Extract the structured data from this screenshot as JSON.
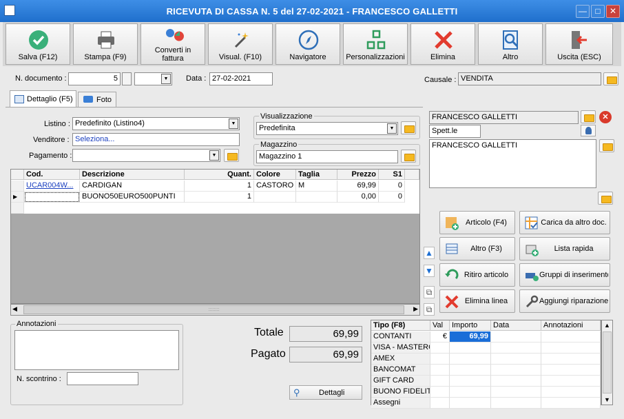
{
  "window": {
    "title": "RICEVUTA DI CASSA N. 5 del 27-02-2021 - FRANCESCO GALLETTI",
    "min": "—",
    "max": "□",
    "close": "✕"
  },
  "toolbar": [
    {
      "label": "Salva (F12)",
      "icon": "check-icon"
    },
    {
      "label": "Stampa (F9)",
      "icon": "printer-icon"
    },
    {
      "label": "Converti in fattura",
      "icon": "convert-icon"
    },
    {
      "label": "Visual. (F10)",
      "icon": "magic-wand-icon"
    },
    {
      "label": "Navigatore",
      "icon": "compass-icon"
    },
    {
      "label": "Personalizzazioni",
      "icon": "grid-icon"
    },
    {
      "label": "Elimina",
      "icon": "delete-x-icon"
    },
    {
      "label": "Altro",
      "icon": "search-doc-icon"
    },
    {
      "label": "Uscita (ESC)",
      "icon": "exit-icon"
    }
  ],
  "header": {
    "doc_label": "N. documento :",
    "doc_number": "5",
    "date_label": "Data :",
    "date": "27-02-2021",
    "causale_label": "Causale :",
    "causale": "VENDITA"
  },
  "tabs": [
    {
      "label": "Dettaglio (F5)"
    },
    {
      "label": "Foto"
    }
  ],
  "form": {
    "listino_label": "Listino :",
    "listino": "Predefinito (Listino4)",
    "venditore_label": "Venditore :",
    "venditore": "Seleziona...",
    "pagamento_label": "Pagamento :",
    "pagamento": "",
    "visual_label": "Visualizzazione",
    "visual": "Predefinita",
    "magazzino_label": "Magazzino",
    "magazzino": "Magazzino 1"
  },
  "customer": {
    "name": "FRANCESCO GALLETTI",
    "salutation": "Spett.le",
    "address": "FRANCESCO GALLETTI"
  },
  "grid": {
    "columns": [
      "Cod.",
      "Descrizione",
      "Quant.",
      "Colore",
      "Taglia",
      "Prezzo",
      "S1"
    ],
    "rows": [
      [
        "UCAR004W...",
        "CARDIGAN",
        "1",
        "CASTORO",
        "M",
        "69,99",
        "0"
      ],
      [
        "",
        "BUONO50EURO500PUNTI",
        "1",
        "",
        "",
        "0,00",
        "0"
      ]
    ],
    "scroll_grip": "::::::::"
  },
  "actions": [
    {
      "label": "Articolo (F4)",
      "icon": "add-article-icon"
    },
    {
      "label": "Carica da altro doc.",
      "icon": "load-doc-icon"
    },
    {
      "label": "Altro (F3)",
      "icon": "more-rows-icon"
    },
    {
      "label": "Lista rapida",
      "icon": "quick-list-icon"
    },
    {
      "label": "Ritiro articolo",
      "icon": "return-arrow-icon"
    },
    {
      "label": "Gruppi di inserimento",
      "icon": "group-insert-icon"
    },
    {
      "label": "Elimina linea",
      "icon": "delete-line-icon"
    },
    {
      "label": "Aggiungi riparazione",
      "icon": "wrench-icon"
    }
  ],
  "notes": {
    "label": "Annotazioni",
    "scontrino_label": "N. scontrino :"
  },
  "totals": {
    "totale_label": "Totale",
    "totale": "69,99",
    "pagato_label": "Pagato",
    "pagato": "69,99",
    "dettagli": "Dettagli"
  },
  "payments": {
    "columns": [
      "Tipo (F8)",
      "Val",
      "Importo",
      "Data",
      "Annotazioni"
    ],
    "rows": [
      {
        "tipo": "CONTANTI",
        "val": "€",
        "importo": "69,99"
      },
      {
        "tipo": "VISA - MASTERCA",
        "val": "",
        "importo": ""
      },
      {
        "tipo": "AMEX",
        "val": "",
        "importo": ""
      },
      {
        "tipo": "BANCOMAT",
        "val": "",
        "importo": ""
      },
      {
        "tipo": "GIFT CARD",
        "val": "",
        "importo": ""
      },
      {
        "tipo": "BUONO FIDELITY",
        "val": "",
        "importo": ""
      },
      {
        "tipo": "Assegni",
        "val": "",
        "importo": ""
      }
    ]
  }
}
